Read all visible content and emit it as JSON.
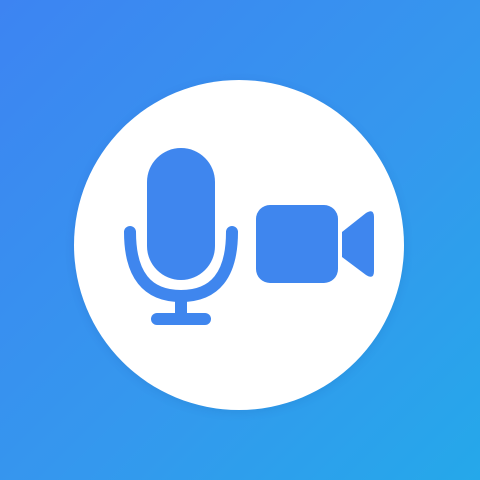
{
  "app_icon": {
    "name": "microphone-and-video-camera",
    "background_gradient": [
      "#3d84f2",
      "#3597ee",
      "#25a8ea"
    ],
    "disc_color": "#ffffff",
    "glyph_color": "#3f86ee",
    "icons": [
      "microphone-icon",
      "video-camera-icon"
    ]
  }
}
